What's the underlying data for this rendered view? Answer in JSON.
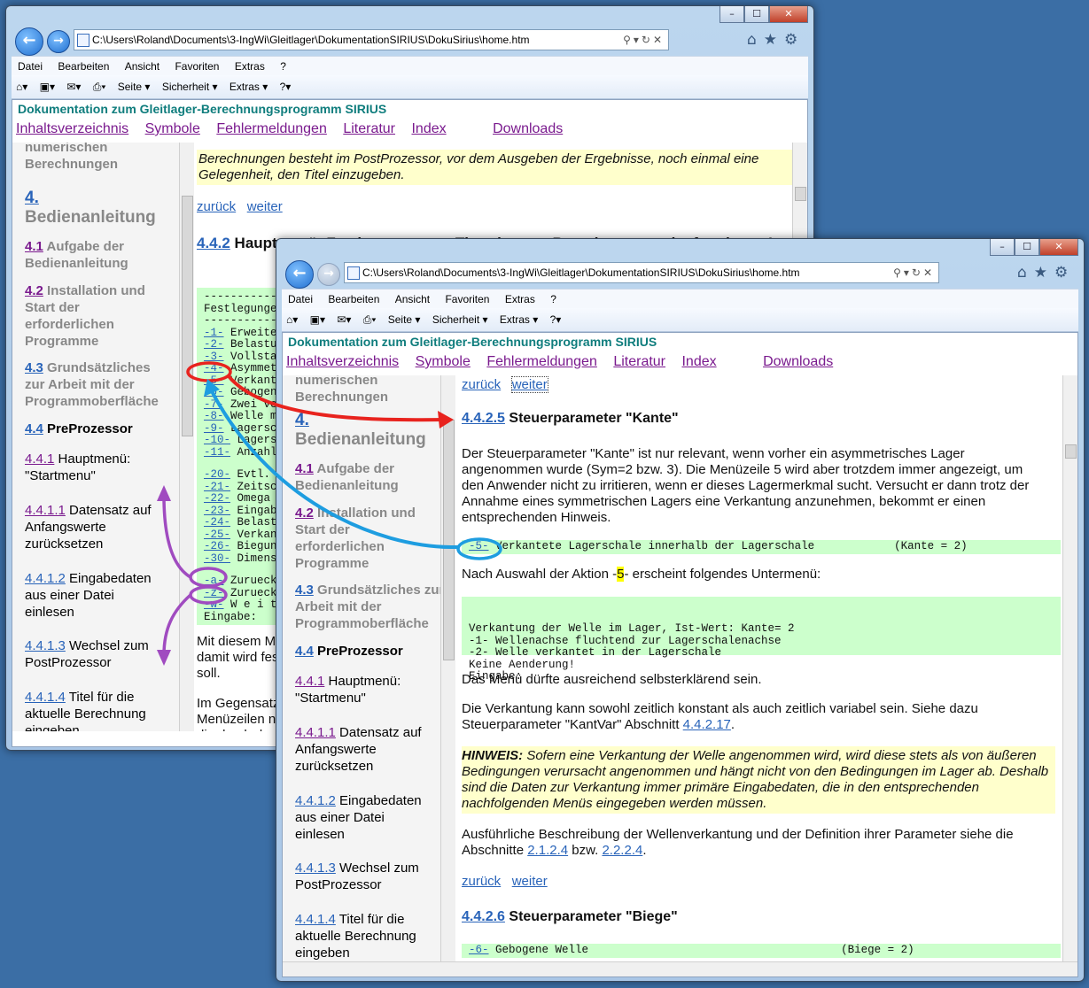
{
  "browser": {
    "address": "C:\\Users\\Roland\\Documents\\3-IngWi\\Gleitlager\\DokumentationSIRIUS\\DokuSirius\\home.htm",
    "menu": [
      "Datei",
      "Bearbeiten",
      "Ansicht",
      "Favoriten",
      "Extras",
      "?"
    ],
    "cmd": [
      "Seite ▾",
      "Sicherheit ▾",
      "Extras ▾"
    ]
  },
  "doc": {
    "title": "Dokumentation zum Gleitlager-Berechnungsprogramm SIRIUS",
    "nav": [
      "Inhaltsverzeichnis",
      "Symbole",
      "Fehlermeldungen",
      "Literatur",
      "Index",
      "Downloads"
    ]
  },
  "sidebar": {
    "top": "numerischen Berechnungen",
    "h4": {
      "num": "4.",
      "label": "Bedienanleitung"
    },
    "s41": {
      "num": "4.1",
      "label": "Aufgabe der Bedienanleitung"
    },
    "s42": {
      "num": "4.2",
      "label": "Installation und Start der erforderlichen Programme"
    },
    "s43": {
      "num": "4.3",
      "label": "Grundsätzliches zur Arbeit mit der Programmoberfläche"
    },
    "s44": {
      "num": "4.4",
      "label": "PreProzessor"
    },
    "s441": {
      "num": "4.4.1",
      "label": "Hauptmenü: \"Startmenu\""
    },
    "s4411": {
      "num": "4.4.1.1",
      "label": "Datensatz auf Anfangswerte zurücksetzen"
    },
    "s4412": {
      "num": "4.4.1.2",
      "label": "Eingabedaten aus einer Datei einlesen"
    },
    "s4413": {
      "num": "4.4.1.3",
      "label": "Wechsel zum PostProzessor"
    },
    "s4414": {
      "num": "4.4.1.4",
      "label": "Titel für die aktuelle Berechnung eingeben"
    }
  },
  "back": {
    "yellow": "Berechnungen besteht im PostProzessor, vor dem Ausgeben der Ergebnisse, noch einmal eine Gelegenheit, den Titel einzugeben.",
    "zurueck": "zurück",
    "weiter": "weiter",
    "h_num": "4.4.2",
    "h_text": "Hauptmenü: Festlegungen zur Theorie, zum Berechnungsverlauf und zum L",
    "menu_head": "Festlegunge",
    "menu_items": [
      [
        "-1-",
        "Erweite"
      ],
      [
        "-2-",
        "Belastu"
      ],
      [
        "-3-",
        "Vollsta"
      ],
      [
        "-4-",
        "Asymmet"
      ],
      [
        "-5-",
        "Verkant"
      ],
      [
        "-6-",
        "Gebogen"
      ],
      [
        "-7-",
        "Zwei ve"
      ],
      [
        "-8-",
        "Welle m"
      ],
      [
        "-9-",
        "Lagersc"
      ],
      [
        "-10-",
        "Lagers"
      ],
      [
        "-11-",
        "Anzahl"
      ]
    ],
    "menu_items2": [
      [
        "-20-",
        "Evtl."
      ],
      [
        "-21-",
        "Zeitsc"
      ],
      [
        "-22-",
        "Omega"
      ],
      [
        "-23-",
        "Eingab"
      ],
      [
        "-24-",
        "Belast"
      ],
      [
        "-25-",
        "Verkan"
      ],
      [
        "-26-",
        "Biegun"
      ],
      [
        "-30-",
        "Dimens"
      ]
    ],
    "menu_items3": [
      [
        "-a-",
        "Zurueck"
      ],
      [
        "-z-",
        "Zurueck"
      ],
      [
        "-w-",
        "W e i t"
      ]
    ],
    "menu_eingabe": "Eingabe:",
    "p1": "Mit diesem M damit wird fes soll.",
    "p2": "Im Gegensatz Menüzeilen n die durch den"
  },
  "front": {
    "zurueck": "zurück",
    "weiter": "weiter",
    "h1_num": "4.4.2.5",
    "h1_text": "Steuerparameter \"Kante\"",
    "p1": "Der Steuerparameter \"Kante\" ist nur relevant, wenn vorher ein asymmetrisches Lager angenommen wurde (Sym=2 bzw. 3). Die Menüzeile 5 wird aber trotzdem immer angezeigt, um den Anwender nicht zu irritieren, wenn er dieses Lagermerkmal sucht. Versucht er dann trotz der Annahme eines symmetrischen Lagers eine Verkantung anzunehmen, bekommt er einen entsprechenden Hinweis.",
    "code5_num": "-5-",
    "code5_text": " Verkantete Lagerschale innerhalb der Lagerschale            (Kante = 2)",
    "p2a": "Nach Auswahl der Aktion -",
    "p2b": "5",
    "p2c": "- erscheint folgendes Untermenü:",
    "sub": [
      "Verkantung der Welle im Lager, Ist-Wert: Kante= 2",
      "-1- Wellenachse fluchtend zur Lagerschalenachse",
      "-2- Welle verkantet in der Lagerschale",
      "Keine Aenderung!",
      "Eingabe:"
    ],
    "p3": "Das Menü dürfte ausreichend selbsterklärend sein.",
    "p4a": "Die Verkantung kann sowohl zeitlich konstant als auch zeitlich variabel sein. Siehe dazu Steuerparameter \"KantVar\" Abschnitt ",
    "p4link": "4.4.2.17",
    "p4b": ".",
    "hinweis_label": "HINWEIS:",
    "hinweis": " Sofern eine Verkantung der Welle angenommen wird, wird diese stets als von äußeren Bedingungen verursacht angenommen und hängt nicht von den Bedingungen im Lager ab. Deshalb sind die Daten zur Verkantung immer primäre Eingabedaten, die in den entsprechenden nachfolgenden Menüs eingegeben werden müssen.",
    "p5a": "Ausführliche Beschreibung der Wellenverkantung und der Definition ihrer Parameter siehe die Abschnitte ",
    "p5l1": "2.1.2.4",
    "p5b": " bzw. ",
    "p5l2": "2.2.2.4",
    "p5c": ".",
    "h2_num": "4.4.2.6",
    "h2_text": "Steuerparameter \"Biege\"",
    "code6_num": "-6-",
    "code6_text": " Gebogene Welle                                      (Biege = 2)"
  },
  "colors": {
    "accent_red": "#e8231e",
    "accent_blue": "#1e9de0",
    "accent_purple": "#a04bc0",
    "title_teal": "#0f7d7d"
  }
}
